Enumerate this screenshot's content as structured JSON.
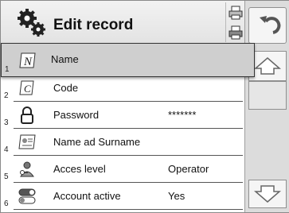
{
  "header": {
    "title": "Edit record"
  },
  "icons": {
    "header": "gears-icon",
    "side_top": "printer-icon",
    "side_bottom": "printer-icon",
    "back": "back-arrow-icon",
    "up": "arrow-up-icon",
    "down": "arrow-down-icon"
  },
  "rows": [
    {
      "num": "1",
      "label": "Name",
      "value": "",
      "icon": "name-letter-n-icon"
    },
    {
      "num": "2",
      "label": "Code",
      "value": "",
      "icon": "code-letter-c-icon"
    },
    {
      "num": "3",
      "label": "Password",
      "value": "*******",
      "icon": "padlock-icon"
    },
    {
      "num": "4",
      "label": "Name ad Surname",
      "value": "",
      "icon": "id-card-icon"
    },
    {
      "num": "5",
      "label": "Acces level",
      "value": "Operator",
      "icon": "user-key-icon"
    },
    {
      "num": "6",
      "label": "Account active",
      "value": "Yes",
      "icon": "toggle-switch-icon"
    }
  ],
  "colors": {
    "selected_row": "#cfcfcf",
    "panel": "#dcdcdc"
  }
}
